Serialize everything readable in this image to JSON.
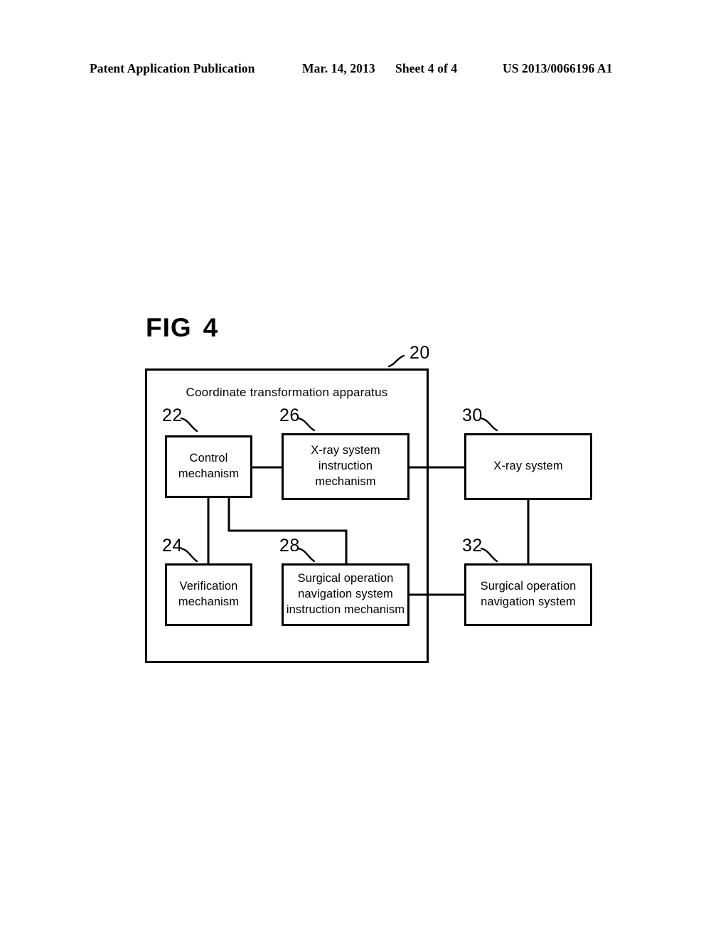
{
  "page_header": {
    "publication": "Patent Application Publication",
    "date": "Mar. 14, 2013",
    "sheet": "Sheet 4 of 4",
    "patent_number": "US 2013/0066196 A1"
  },
  "figure": {
    "label_prefix": "FIG",
    "label_number": "4"
  },
  "diagram": {
    "container": {
      "ref": "20",
      "title": "Coordinate transformation apparatus"
    },
    "boxes": [
      {
        "ref": "22",
        "label": "Control\nmechanism"
      },
      {
        "ref": "26",
        "label": "X-ray system\ninstruction\nmechanism"
      },
      {
        "ref": "30",
        "label": "X-ray system"
      },
      {
        "ref": "24",
        "label": "Verification\nmechanism"
      },
      {
        "ref": "28",
        "label": "Surgical operation\nnavigation system\ninstruction mechanism"
      },
      {
        "ref": "32",
        "label": "Surgical operation\nnavigation system"
      }
    ],
    "connections": [
      {
        "from": "22",
        "to": "26"
      },
      {
        "from": "26",
        "to": "30"
      },
      {
        "from": "22",
        "to": "24"
      },
      {
        "from": "22",
        "to": "28"
      },
      {
        "from": "28",
        "to": "32"
      },
      {
        "from": "30",
        "to": "32"
      }
    ],
    "colors": {
      "stroke": "#000000",
      "background": "#ffffff"
    }
  }
}
